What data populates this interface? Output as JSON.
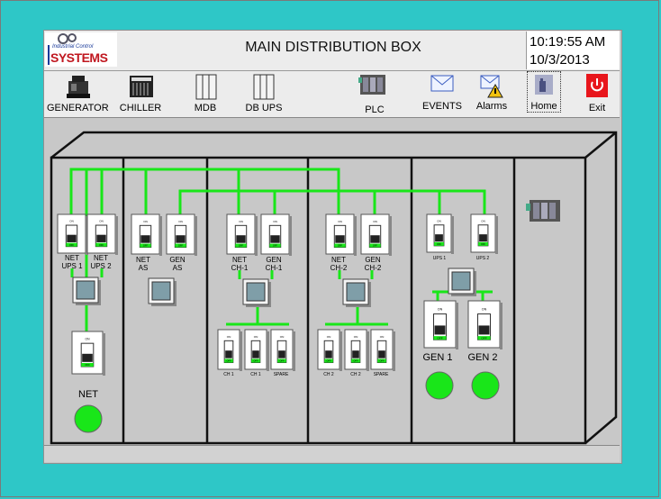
{
  "header": {
    "logo_text": "SYSTEMS",
    "logo_subtext": "Industrial Control",
    "title": "MAIN DISTRIBUTION BOX",
    "time": "10:19:55 AM",
    "date": "10/3/2013"
  },
  "toolbar": {
    "generator": "GENERATOR",
    "chiller": "CHILLER",
    "mdb": "MDB",
    "db_ups": "DB UPS",
    "plc": "PLC",
    "events": "EVENTS",
    "alarms": "Alarms",
    "home": "Home",
    "exit": "Exit"
  },
  "switch_text": {
    "on": "ON",
    "off": "OFF"
  },
  "breakers": {
    "net_ups1": "NET\nUPS 1",
    "net_ups2": "NET\nUPS 2",
    "net_as": "NET\nAS",
    "gen_as": "GEN\nAS",
    "net_ch1": "NET\nCH-1",
    "gen_ch1": "GEN\nCH-1",
    "net_ch2": "NET\nCH-2",
    "gen_ch2": "GEN\nCH-2",
    "ups1": "UPS 1",
    "ups2": "UPS 2",
    "ch1_a": "CH 1",
    "ch1_b": "CH 1",
    "spare1": "SPARE",
    "ch2_a": "CH 2",
    "ch2_b": "CH 2",
    "spare2": "SPARE",
    "gen1": "GEN 1",
    "gen2": "GEN 2",
    "net": "NET"
  },
  "colors": {
    "bus": "#19e619",
    "indicator": "#19e619",
    "background": "#2ec7c7"
  }
}
